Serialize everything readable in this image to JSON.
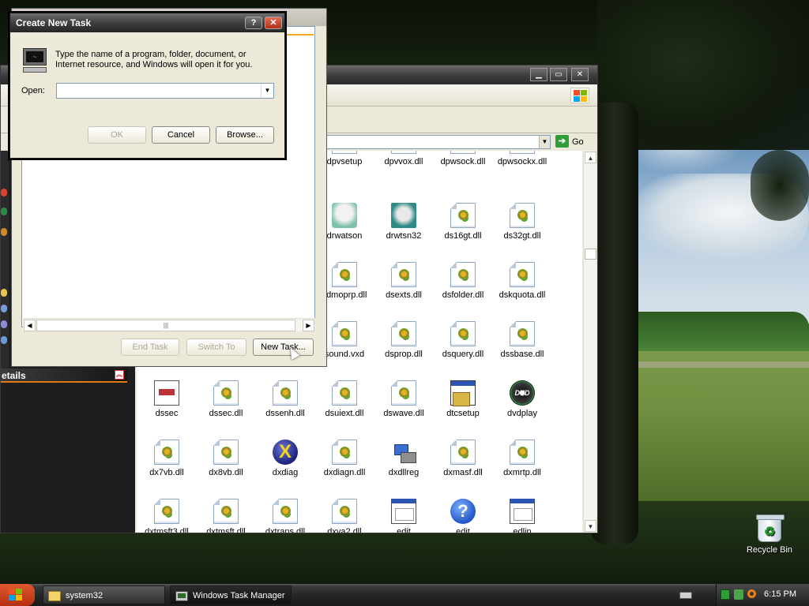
{
  "explorer": {
    "address_go": "Go",
    "sidebar": {
      "details_label": "etails"
    },
    "files": [
      {
        "name": "dpvsetup",
        "type": "partial"
      },
      {
        "name": "dpvvox.dll",
        "type": "partial"
      },
      {
        "name": "dpwsock.dll",
        "type": "partial"
      },
      {
        "name": "dpwsockx.dll",
        "type": "partial"
      },
      {
        "name": "drwatson",
        "type": "watson"
      },
      {
        "name": "drwtsn32",
        "type": "watson2"
      },
      {
        "name": "ds16gt.dll",
        "type": "dll"
      },
      {
        "name": "ds32gt.dll",
        "type": "dll"
      },
      {
        "name": "sdmoprp.dll",
        "type": "dll"
      },
      {
        "name": "dsexts.dll",
        "type": "dll"
      },
      {
        "name": "dsfolder.dll",
        "type": "dll"
      },
      {
        "name": "dskquota.dll",
        "type": "dll"
      },
      {
        "name": "sound.vxd",
        "type": "dll"
      },
      {
        "name": "dsprop.dll",
        "type": "dll"
      },
      {
        "name": "dsquery.dll",
        "type": "dll"
      },
      {
        "name": "dssbase.dll",
        "type": "dll"
      },
      {
        "name": "dssec",
        "type": "sec"
      },
      {
        "name": "dssec.dll",
        "type": "dll"
      },
      {
        "name": "dssenh.dll",
        "type": "dll"
      },
      {
        "name": "dsuiext.dll",
        "type": "dll"
      },
      {
        "name": "dswave.dll",
        "type": "dll"
      },
      {
        "name": "dtcsetup",
        "type": "setup"
      },
      {
        "name": "dvdplay",
        "type": "dvd"
      },
      {
        "name": "dx7vb.dll",
        "type": "dll"
      },
      {
        "name": "dx8vb.dll",
        "type": "dll"
      },
      {
        "name": "dxdiag",
        "type": "dxdiag"
      },
      {
        "name": "dxdiagn.dll",
        "type": "dll"
      },
      {
        "name": "dxdllreg",
        "type": "reg"
      },
      {
        "name": "dxmasf.dll",
        "type": "dll"
      },
      {
        "name": "dxmrtp.dll",
        "type": "dll"
      },
      {
        "name": "dxtmsft3.dll",
        "type": "dll"
      },
      {
        "name": "dxtmsft.dll",
        "type": "dll"
      },
      {
        "name": "dxtrans.dll",
        "type": "dll"
      },
      {
        "name": "dxva2.dll",
        "type": "dll"
      },
      {
        "name": "edit",
        "type": "exe"
      },
      {
        "name": "edit",
        "type": "help"
      },
      {
        "name": "edlin",
        "type": "exe"
      }
    ]
  },
  "task_manager": {
    "buttons": {
      "end_task": "End Task",
      "switch_to": "Switch To",
      "new_task": "New Task..."
    }
  },
  "dialog": {
    "title": "Create New Task",
    "help_glyph": "?",
    "close_glyph": "✕",
    "description": "Type the name of a program, folder, document, or Internet resource, and Windows will open it for you.",
    "open_label": "Open:",
    "open_value": "",
    "ok_label": "OK",
    "cancel_label": "Cancel",
    "browse_label": "Browse..."
  },
  "desktop": {
    "recycle_bin_label": "Recycle Bin"
  },
  "taskbar": {
    "buttons": [
      {
        "label": "system32",
        "icon": "folder-icon"
      },
      {
        "label": "Windows Task Manager",
        "icon": "task-manager-icon"
      }
    ],
    "clock": "6:15 PM"
  },
  "colors": {
    "accent_orange": "#f2a81c",
    "go_green": "#2f9e3a"
  }
}
